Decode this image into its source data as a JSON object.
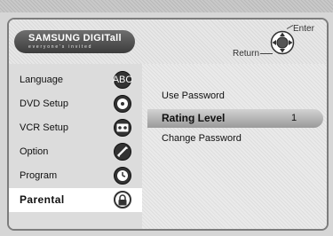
{
  "logo": {
    "brand": "SAMSUNG DIGITall",
    "tagline": "everyone's invited"
  },
  "nav_hints": {
    "enter": "Enter",
    "return": "Return"
  },
  "menu": {
    "items": [
      {
        "label": "Language",
        "icon": "language-icon"
      },
      {
        "label": "DVD Setup",
        "icon": "disc-icon"
      },
      {
        "label": "VCR Setup",
        "icon": "tape-icon"
      },
      {
        "label": "Option",
        "icon": "option-icon"
      },
      {
        "label": "Program",
        "icon": "program-icon"
      },
      {
        "label": "Parental",
        "icon": "lock-icon"
      }
    ],
    "selected_index": 5
  },
  "parental": {
    "options": [
      {
        "label": "Use Password",
        "value": ""
      },
      {
        "label": "Rating Level",
        "value": "1"
      },
      {
        "label": "Change Password",
        "value": ""
      }
    ],
    "selected_index": 1
  },
  "colors": {
    "highlight_bar": "#a8a8a8",
    "selected_tab": "#ffffff",
    "logo_bg": "#4a4a4a"
  }
}
